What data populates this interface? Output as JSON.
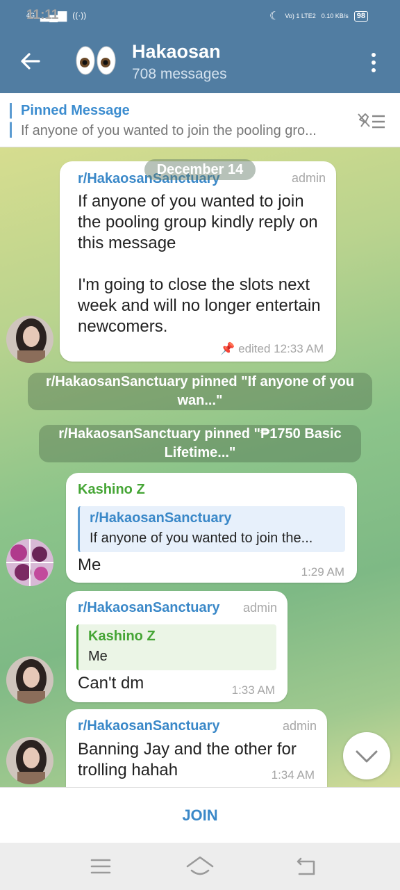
{
  "status_bar": {
    "network": "4G",
    "time": "11:11",
    "volte": "Vo) 1 LTE2",
    "speed": "0.10 KB/s",
    "battery": "98"
  },
  "header": {
    "title": "Hakaosan",
    "subtitle": "708 messages",
    "color": "#517da2"
  },
  "pinned": {
    "label": "Pinned Message",
    "text": "If anyone of you wanted to join the pooling gro..."
  },
  "chat": {
    "date": "December 14",
    "messages": [
      {
        "sender": "r/HakaosanSanctuary",
        "badge": "admin",
        "text": "If anyone of you wanted to join the pooling group kindly reply on this message\n\nI'm going to close the slots next week and will no longer entertain newcomers.",
        "time": "edited 12:33 AM"
      },
      {
        "sender": "Kashino Z",
        "reply_to": {
          "name": "r/HakaosanSanctuary",
          "text": "If anyone of you wanted to join the..."
        },
        "text": "Me",
        "time": "1:29 AM"
      },
      {
        "sender": "r/HakaosanSanctuary",
        "badge": "admin",
        "reply_to": {
          "name": "Kashino Z",
          "text": "Me"
        },
        "text": "Can't dm",
        "time": "1:33 AM"
      },
      {
        "sender": "r/HakaosanSanctuary",
        "badge": "admin",
        "text": "Banning Jay and the other for trolling hahah",
        "time": "1:34 AM"
      }
    ],
    "service": [
      "r/HakaosanSanctuary pinned \"If anyone of you wan...\"",
      "r/HakaosanSanctuary pinned \"₱1750 Basic Lifetime...\""
    ]
  },
  "footer": {
    "join_label": "JOIN"
  },
  "icons": [
    "back-arrow-icon",
    "eyes-emoji-icon",
    "more-vertical-icon",
    "unpin-icon",
    "chevron-down-icon",
    "menu-icon",
    "home-icon",
    "back-nav-icon"
  ]
}
